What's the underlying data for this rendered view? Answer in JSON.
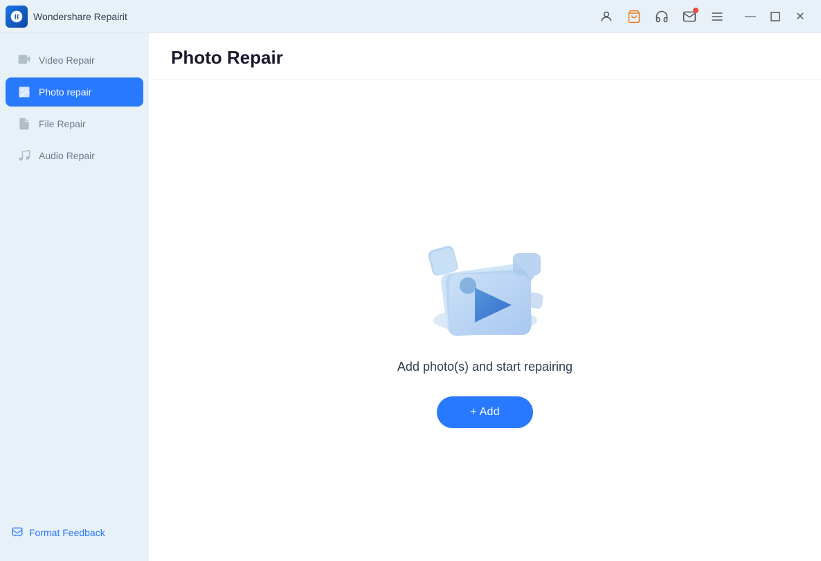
{
  "app": {
    "name": "Wondershare Repairit",
    "logo_aria": "repairit-logo"
  },
  "titlebar": {
    "icons": [
      {
        "name": "account-icon",
        "glyph": "👤"
      },
      {
        "name": "cart-icon",
        "glyph": "🛒"
      },
      {
        "name": "support-icon",
        "glyph": "🎧"
      },
      {
        "name": "mail-icon",
        "glyph": "✉",
        "has_badge": true
      },
      {
        "name": "menu-icon",
        "glyph": "☰"
      }
    ],
    "window_controls": [
      {
        "name": "minimize-button",
        "glyph": "—"
      },
      {
        "name": "maximize-button",
        "glyph": "□"
      },
      {
        "name": "close-button",
        "glyph": "✕"
      }
    ]
  },
  "sidebar": {
    "items": [
      {
        "id": "video-repair",
        "label": "Video Repair",
        "active": false
      },
      {
        "id": "photo-repair",
        "label": "Photo repair",
        "active": true
      },
      {
        "id": "file-repair",
        "label": "File Repair",
        "active": false
      },
      {
        "id": "audio-repair",
        "label": "Audio Repair",
        "active": false
      }
    ],
    "footer": {
      "feedback_label": "Format Feedback",
      "feedback_icon": "feedback-icon"
    }
  },
  "main": {
    "page_title": "Photo Repair",
    "empty_state": {
      "description": "Add photo(s) and start repairing",
      "add_button_label": "+ Add"
    }
  },
  "colors": {
    "accent": "#2979ff",
    "sidebar_bg": "#e8f0f8",
    "active_item": "#2979ff",
    "inactive_text": "#6b7a8d"
  }
}
